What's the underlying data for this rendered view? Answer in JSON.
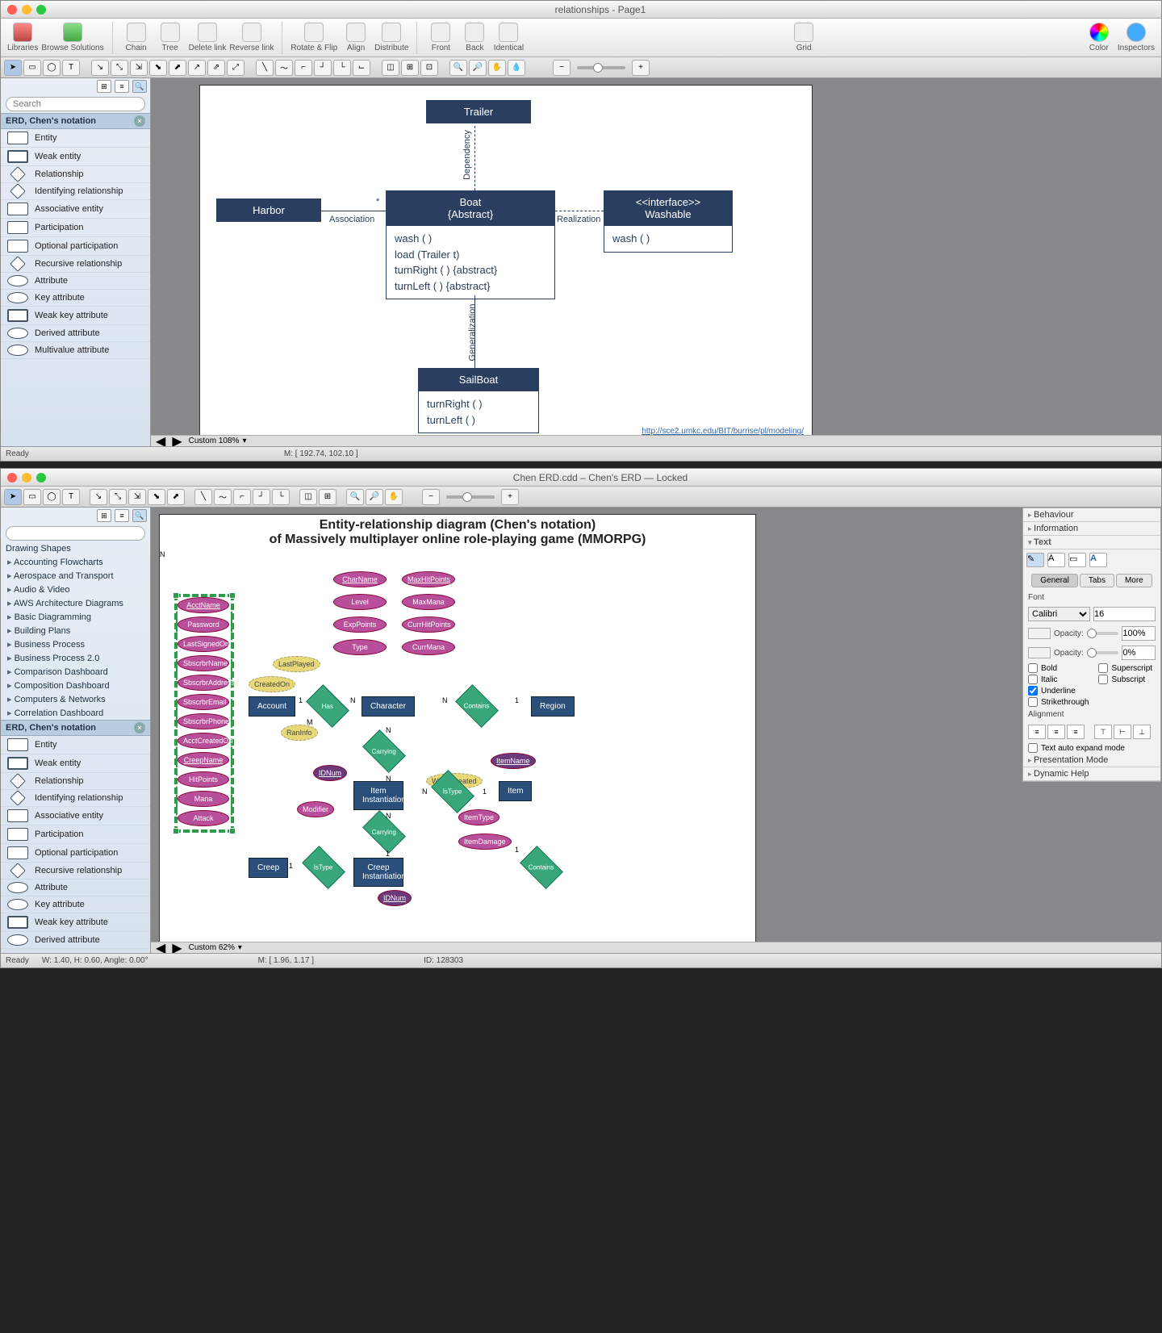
{
  "win1": {
    "title": "relationships - Page1",
    "toolbar1": [
      "Libraries",
      "Browse Solutions",
      "Chain",
      "Tree",
      "Delete link",
      "Reverse link",
      "Rotate & Flip",
      "Align",
      "Distribute",
      "Front",
      "Back",
      "Identical",
      "Grid",
      "Color",
      "Inspectors"
    ],
    "search_placeholder": "Search",
    "lib_header": "ERD, Chen's notation",
    "lib_items": [
      "Entity",
      "Weak entity",
      "Relationship",
      "Identifying relationship",
      "Associative entity",
      "Participation",
      "Optional participation",
      "Recursive relationship",
      "Attribute",
      "Key attribute",
      "Weak key attribute",
      "Derived attribute",
      "Multivalue attribute"
    ],
    "status_left": "Ready",
    "zoom": "Custom 108%",
    "status_mouse": "M: [ 192.74, 102.10 ]",
    "url": "http://sce2.umkc.edu/BIT/burrise/pl/modeling/",
    "uml": {
      "trailer": "Trailer",
      "harbor": "Harbor",
      "boat_hdr1": "Boat",
      "boat_hdr2": "{Abstract}",
      "boat_ops": [
        "wash ( )",
        "load (Trailer t)",
        "turnRight ( ) {abstract}",
        "turnLeft ( ) {abstract}"
      ],
      "iface_hdr1": "<<interface>>",
      "iface_hdr2": "Washable",
      "iface_ops": [
        "wash ( )"
      ],
      "sail_hdr": "SailBoat",
      "sail_ops": [
        "turnRight ( )",
        "turnLeft ( )"
      ],
      "lbl_dep": "Dependency",
      "lbl_assoc": "Association",
      "lbl_real": "Realization",
      "lbl_gen": "Generalization",
      "star": "*"
    }
  },
  "win2": {
    "title": "Chen ERD.cdd – Chen's ERD — Locked",
    "search_placeholder": "",
    "tree_header": "Drawing Shapes",
    "tree_items": [
      "Accounting Flowcharts",
      "Aerospace and Transport",
      "Audio & Video",
      "AWS Architecture Diagrams",
      "Basic Diagramming",
      "Building Plans",
      "Business Process",
      "Business Process 2.0",
      "Comparison Dashboard",
      "Composition Dashboard",
      "Computers & Networks",
      "Correlation Dashboard"
    ],
    "lib_header": "ERD, Chen's notation",
    "lib_items": [
      "Entity",
      "Weak entity",
      "Relationship",
      "Identifying relationship",
      "Associative entity",
      "Participation",
      "Optional participation",
      "Recursive relationship",
      "Attribute",
      "Key attribute",
      "Weak key attribute",
      "Derived attribute"
    ],
    "canvas_title1": "Entity-relationship diagram (Chen's notation)",
    "canvas_title2": "of Massively multiplayer online role-playing game (MMORPG)",
    "stack_attrs": [
      "AcctName",
      "Password",
      "LastSignedOn",
      "SbscrbrName",
      "SbscrbrAddress",
      "SbscrbrEmail",
      "SbscrbrPhone",
      "AcctCreatedOn",
      "CreepName",
      "HitPoints",
      "Mana",
      "Attack"
    ],
    "col2_attrs": [
      "CharName",
      "Level",
      "ExpPoints",
      "Type"
    ],
    "col3_attrs": [
      "MaxHitPoints",
      "MaxMana",
      "CurrHitPoints",
      "CurrMana"
    ],
    "der_attrs": [
      "LastPlayed",
      "CreatedOn",
      "RanInfo",
      "WhenCreated"
    ],
    "entities": [
      "Account",
      "Character",
      "Item Instantiation",
      "Item",
      "Creep",
      "Creep Instantiation",
      "Region"
    ],
    "rels": [
      "Has",
      "Contains",
      "Carrying",
      "IsType",
      "Carrying",
      "IsType",
      "Contains"
    ],
    "other_attrs": [
      "IDNum",
      "Modifier",
      "ItemName",
      "ItemType",
      "ItemDamage",
      "IDNum"
    ],
    "cardinals": [
      "1",
      "N",
      "M",
      "N",
      "1",
      "N",
      "1",
      "N",
      "1",
      "N",
      "1"
    ],
    "status_left": "Ready",
    "status_wh": "W: 1.40, H: 0.60, Angle: 0.00°",
    "status_mouse": "M: [ 1.96, 1.17 ]",
    "status_id": "ID: 128303",
    "zoom": "Custom 62%",
    "inspector": {
      "secs": [
        "Behaviour",
        "Information",
        "Text"
      ],
      "tabs": [
        "General",
        "Tabs",
        "More"
      ],
      "font_label": "Font",
      "font": "Calibri",
      "size": "16",
      "opacity_label": "Opacity:",
      "opacity1": "100%",
      "opacity2": "0%",
      "checks1": [
        "Bold",
        "Italic",
        "Underline",
        "Strikethrough"
      ],
      "checks2": [
        "Superscript",
        "Subscript"
      ],
      "underline_checked": true,
      "align_label": "Alignment",
      "autoexpand": "Text auto expand mode",
      "more_secs": [
        "Presentation Mode",
        "Dynamic Help"
      ]
    }
  }
}
